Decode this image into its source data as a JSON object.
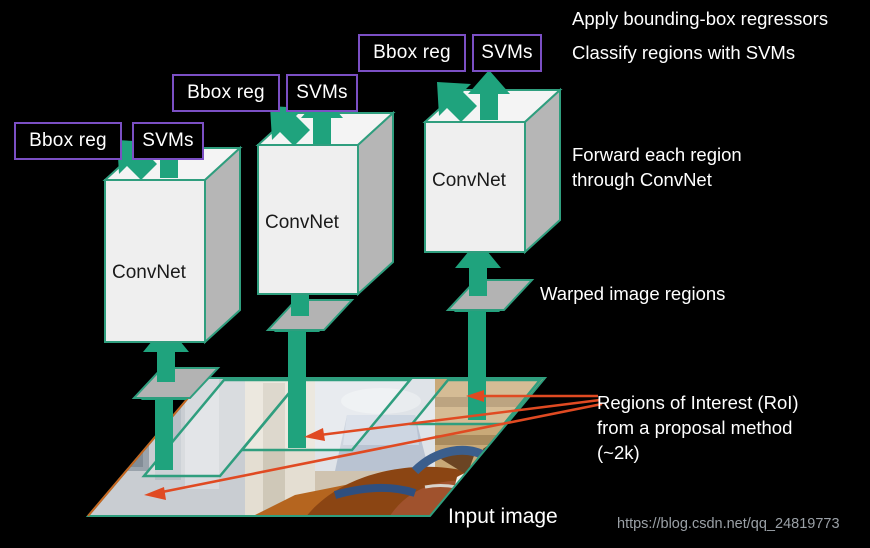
{
  "diagram": {
    "title": "R-CNN pipeline diagram",
    "background_color": "#000000"
  },
  "colors": {
    "purple_box_border": "#7b4fc4",
    "teal_arrow": "#1fa37d",
    "cube_edge": "#2f9e7e",
    "cube_front": "#efefef",
    "cube_side": "#b6b6b6",
    "cube_top": "#f4f4f4",
    "warped_region_fill": "#b3b3b3",
    "red_arrow": "#e04a22",
    "text_light": "#ffffff",
    "text_dark": "#1a1a1a",
    "watermark_color": "#9aa0a6"
  },
  "stages": [
    {
      "id": "stage-left",
      "bbox_label": "Bbox reg",
      "svm_label": "SVMs",
      "convnet_label": "ConvNet"
    },
    {
      "id": "stage-middle",
      "bbox_label": "Bbox reg",
      "svm_label": "SVMs",
      "convnet_label": "ConvNet"
    },
    {
      "id": "stage-right",
      "bbox_label": "Bbox reg",
      "svm_label": "SVMs",
      "convnet_label": "ConvNet"
    }
  ],
  "annotations": {
    "apply_bbox": "Apply bounding-box regressors",
    "classify": "Classify regions with SVMs",
    "forward": "Forward each region\nthrough ConvNet",
    "warped": "Warped image regions",
    "roi": "Regions of Interest (RoI)\nfrom a proposal method\n(~2k)",
    "input_image": "Input image"
  },
  "watermark": "https://blog.csdn.net/qq_24819773"
}
